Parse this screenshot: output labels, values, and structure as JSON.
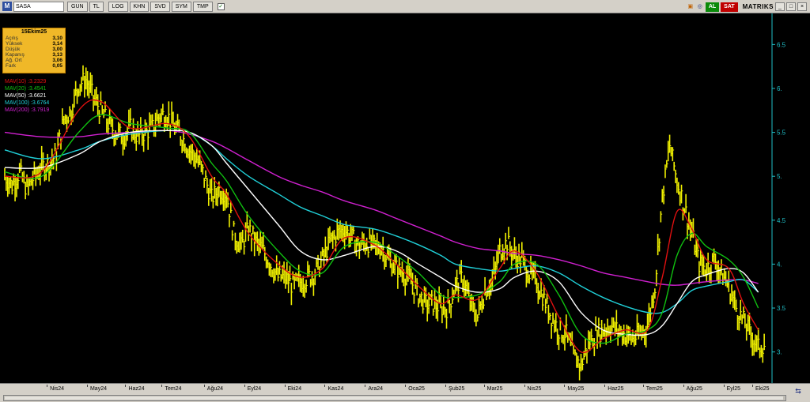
{
  "toolbar": {
    "app_icon": "M",
    "symbol": "SASA",
    "buttons": [
      "GUN",
      "TL",
      "LOG",
      "KHN",
      "SVD",
      "SYM",
      "TMP"
    ],
    "checkbox_glyph": "✓",
    "right": {
      "al_label": "AL",
      "sat_label": "SAT",
      "matriks_label": "MATRIKS"
    }
  },
  "info_box": {
    "date": "15Ekim25",
    "rows": [
      {
        "label": "Açılış",
        "value": "3,10"
      },
      {
        "label": "Yüksek",
        "value": "3,14"
      },
      {
        "label": "Düşük",
        "value": "3,00"
      },
      {
        "label": "Kapanış",
        "value": "3,13"
      },
      {
        "label": "Ağ. Ort",
        "value": "3,06"
      },
      {
        "label": "Fark",
        "value": "0,05"
      }
    ]
  },
  "legend": [
    {
      "label": "MAV(10)",
      "value": ":3.2329",
      "color": "#e01010"
    },
    {
      "label": "MAV(20)",
      "value": ":3.4541",
      "color": "#10c010"
    },
    {
      "label": "MAV(50)",
      "value": ":3.6621",
      "color": "#ffffff"
    },
    {
      "label": "MAV(100)",
      "value": ":3.6764",
      "color": "#20d0d8"
    },
    {
      "label": "MAV(200)",
      "value": ":3.7919",
      "color": "#d020d0"
    }
  ],
  "chart_data": {
    "type": "line",
    "price_color": "#f0f000",
    "axis_color": "#20c0c8",
    "ylim": [
      2.7,
      6.8
    ],
    "y_ticks": [
      {
        "value": 6.5,
        "label": "6.5"
      },
      {
        "value": 6.0,
        "label": "6."
      },
      {
        "value": 5.5,
        "label": "5.5"
      },
      {
        "value": 5.0,
        "label": "5."
      },
      {
        "value": 4.5,
        "label": "4.5"
      },
      {
        "value": 4.0,
        "label": "4."
      },
      {
        "value": 3.5,
        "label": "3.5"
      },
      {
        "value": 3.0,
        "label": "3."
      }
    ],
    "x_labels": [
      "Nis24",
      "May24",
      "Haz24",
      "Tem24",
      "Ağu24",
      "Eyl24",
      "Eki24",
      "Kas24",
      "Ara24",
      "Oca25",
      "Şub25",
      "Mar25",
      "Nis25",
      "May25",
      "Haz25",
      "Tem25",
      "Ağu25",
      "Eyl25",
      "Eki25"
    ],
    "x_label_pos": [
      0.6,
      1.65,
      2.65,
      3.6,
      4.7,
      5.75,
      6.8,
      7.85,
      8.9,
      9.95,
      11.0,
      12.0,
      13.05,
      14.1,
      15.15,
      16.15,
      17.2,
      18.25,
      19.25
    ],
    "x_domain": [
      0,
      19.6
    ],
    "price": [
      [
        0.0,
        5.0
      ],
      [
        0.2,
        4.9
      ],
      [
        0.4,
        5.05
      ],
      [
        0.6,
        4.85
      ],
      [
        0.8,
        5.0
      ],
      [
        1.0,
        5.1
      ],
      [
        1.2,
        5.15
      ],
      [
        1.4,
        5.25
      ],
      [
        1.6,
        5.65
      ],
      [
        1.8,
        5.75
      ],
      [
        2.0,
        6.05
      ],
      [
        2.2,
        6.1
      ],
      [
        2.4,
        5.9
      ],
      [
        2.6,
        5.75
      ],
      [
        2.8,
        5.6
      ],
      [
        3.0,
        5.5
      ],
      [
        3.2,
        5.45
      ],
      [
        3.4,
        5.55
      ],
      [
        3.6,
        5.45
      ],
      [
        3.8,
        5.5
      ],
      [
        4.0,
        5.55
      ],
      [
        4.2,
        5.7
      ],
      [
        4.4,
        5.7
      ],
      [
        4.6,
        5.55
      ],
      [
        4.8,
        5.45
      ],
      [
        5.0,
        5.3
      ],
      [
        5.2,
        5.2
      ],
      [
        5.4,
        5.0
      ],
      [
        5.6,
        4.75
      ],
      [
        5.8,
        4.85
      ],
      [
        6.0,
        4.8
      ],
      [
        6.2,
        4.35
      ],
      [
        6.4,
        4.2
      ],
      [
        6.6,
        4.4
      ],
      [
        6.8,
        4.25
      ],
      [
        7.0,
        4.15
      ],
      [
        7.2,
        4.0
      ],
      [
        7.4,
        3.85
      ],
      [
        7.6,
        3.85
      ],
      [
        7.8,
        3.75
      ],
      [
        8.0,
        3.8
      ],
      [
        8.2,
        3.85
      ],
      [
        8.4,
        3.9
      ],
      [
        8.6,
        4.05
      ],
      [
        8.8,
        4.25
      ],
      [
        9.0,
        4.35
      ],
      [
        9.2,
        4.4
      ],
      [
        9.4,
        4.3
      ],
      [
        9.6,
        4.2
      ],
      [
        9.8,
        4.25
      ],
      [
        10.0,
        4.2
      ],
      [
        10.2,
        4.2
      ],
      [
        10.4,
        4.05
      ],
      [
        10.6,
        3.95
      ],
      [
        10.8,
        3.9
      ],
      [
        11.0,
        3.8
      ],
      [
        11.2,
        3.65
      ],
      [
        11.4,
        3.55
      ],
      [
        11.6,
        3.55
      ],
      [
        11.8,
        3.5
      ],
      [
        12.0,
        3.5
      ],
      [
        12.2,
        3.75
      ],
      [
        12.4,
        3.85
      ],
      [
        12.6,
        3.55
      ],
      [
        12.8,
        3.4
      ],
      [
        13.0,
        3.7
      ],
      [
        13.2,
        3.8
      ],
      [
        13.4,
        4.15
      ],
      [
        13.6,
        4.25
      ],
      [
        13.8,
        4.1
      ],
      [
        14.0,
        4.05
      ],
      [
        14.2,
        3.9
      ],
      [
        14.4,
        3.8
      ],
      [
        14.6,
        3.6
      ],
      [
        14.8,
        3.4
      ],
      [
        15.0,
        3.25
      ],
      [
        15.2,
        3.2
      ],
      [
        15.4,
        2.95
      ],
      [
        15.6,
        2.85
      ],
      [
        15.8,
        3.1
      ],
      [
        16.0,
        3.2
      ],
      [
        16.2,
        3.25
      ],
      [
        16.4,
        3.3
      ],
      [
        16.6,
        3.25
      ],
      [
        16.8,
        3.2
      ],
      [
        17.0,
        3.15
      ],
      [
        17.2,
        3.2
      ],
      [
        17.4,
        3.3
      ],
      [
        17.6,
        3.75
      ],
      [
        17.8,
        4.75
      ],
      [
        18.0,
        5.35
      ],
      [
        18.2,
        4.95
      ],
      [
        18.4,
        4.65
      ],
      [
        18.6,
        4.35
      ],
      [
        18.8,
        4.0
      ],
      [
        19.0,
        3.95
      ],
      [
        19.2,
        4.05
      ],
      [
        19.4,
        3.9
      ],
      [
        19.6,
        3.75
      ],
      [
        19.8,
        3.5
      ],
      [
        20.0,
        3.35
      ],
      [
        20.2,
        3.2
      ],
      [
        20.4,
        3.05
      ],
      [
        20.6,
        3.1
      ]
    ],
    "series": [
      {
        "name": "MAV(10)",
        "color": "#e01010",
        "points": [
          [
            0.0,
            5.0
          ],
          [
            1.0,
            5.05
          ],
          [
            2.0,
            5.75
          ],
          [
            2.6,
            5.85
          ],
          [
            3.4,
            5.55
          ],
          [
            4.4,
            5.6
          ],
          [
            5.0,
            5.45
          ],
          [
            5.6,
            5.0
          ],
          [
            6.0,
            4.8
          ],
          [
            6.6,
            4.35
          ],
          [
            7.4,
            4.0
          ],
          [
            8.0,
            3.85
          ],
          [
            8.6,
            3.95
          ],
          [
            9.2,
            4.3
          ],
          [
            10.0,
            4.22
          ],
          [
            10.6,
            4.0
          ],
          [
            11.2,
            3.75
          ],
          [
            11.8,
            3.55
          ],
          [
            12.2,
            3.65
          ],
          [
            12.8,
            3.6
          ],
          [
            13.4,
            3.95
          ],
          [
            13.8,
            4.15
          ],
          [
            14.4,
            3.9
          ],
          [
            15.0,
            3.4
          ],
          [
            15.6,
            3.0
          ],
          [
            16.2,
            3.15
          ],
          [
            16.8,
            3.25
          ],
          [
            17.4,
            3.25
          ],
          [
            17.8,
            3.85
          ],
          [
            18.2,
            4.6
          ],
          [
            18.6,
            4.4
          ],
          [
            19.0,
            4.05
          ],
          [
            19.6,
            3.95
          ],
          [
            20.0,
            3.55
          ],
          [
            20.4,
            3.25
          ]
        ]
      },
      {
        "name": "MAV(20)",
        "color": "#10c010",
        "points": [
          [
            0.0,
            5.05
          ],
          [
            1.0,
            5.0
          ],
          [
            2.0,
            5.5
          ],
          [
            2.6,
            5.7
          ],
          [
            3.4,
            5.6
          ],
          [
            4.4,
            5.55
          ],
          [
            5.0,
            5.5
          ],
          [
            5.6,
            5.15
          ],
          [
            6.0,
            4.95
          ],
          [
            6.6,
            4.55
          ],
          [
            7.4,
            4.15
          ],
          [
            8.0,
            3.92
          ],
          [
            8.6,
            3.9
          ],
          [
            9.2,
            4.2
          ],
          [
            10.0,
            4.25
          ],
          [
            10.6,
            4.1
          ],
          [
            11.2,
            3.9
          ],
          [
            11.8,
            3.65
          ],
          [
            12.2,
            3.62
          ],
          [
            12.8,
            3.65
          ],
          [
            13.4,
            3.8
          ],
          [
            13.8,
            4.0
          ],
          [
            14.4,
            4.0
          ],
          [
            15.0,
            3.65
          ],
          [
            15.6,
            3.2
          ],
          [
            16.2,
            3.1
          ],
          [
            16.8,
            3.2
          ],
          [
            17.4,
            3.25
          ],
          [
            17.8,
            3.45
          ],
          [
            18.2,
            4.1
          ],
          [
            18.6,
            4.35
          ],
          [
            19.0,
            4.2
          ],
          [
            19.6,
            4.05
          ],
          [
            20.0,
            3.85
          ],
          [
            20.4,
            3.5
          ]
        ]
      },
      {
        "name": "MAV(50)",
        "color": "#ffffff",
        "points": [
          [
            0.0,
            5.1
          ],
          [
            1.0,
            5.1
          ],
          [
            2.0,
            5.25
          ],
          [
            2.6,
            5.4
          ],
          [
            3.4,
            5.5
          ],
          [
            4.4,
            5.52
          ],
          [
            5.0,
            5.5
          ],
          [
            5.6,
            5.35
          ],
          [
            6.0,
            5.15
          ],
          [
            6.6,
            4.85
          ],
          [
            7.4,
            4.45
          ],
          [
            8.0,
            4.15
          ],
          [
            8.6,
            4.05
          ],
          [
            9.2,
            4.1
          ],
          [
            10.0,
            4.2
          ],
          [
            10.6,
            4.15
          ],
          [
            11.2,
            4.0
          ],
          [
            11.8,
            3.85
          ],
          [
            12.2,
            3.75
          ],
          [
            12.8,
            3.68
          ],
          [
            13.4,
            3.72
          ],
          [
            13.8,
            3.85
          ],
          [
            14.4,
            3.92
          ],
          [
            15.0,
            3.8
          ],
          [
            15.6,
            3.45
          ],
          [
            16.2,
            3.25
          ],
          [
            16.8,
            3.2
          ],
          [
            17.4,
            3.2
          ],
          [
            17.8,
            3.3
          ],
          [
            18.2,
            3.55
          ],
          [
            18.6,
            3.8
          ],
          [
            19.0,
            3.88
          ],
          [
            19.6,
            3.95
          ],
          [
            20.0,
            3.9
          ],
          [
            20.4,
            3.68
          ]
        ]
      },
      {
        "name": "MAV(100)",
        "color": "#20d0d8",
        "points": [
          [
            0.0,
            5.3
          ],
          [
            1.0,
            5.2
          ],
          [
            2.0,
            5.3
          ],
          [
            2.6,
            5.4
          ],
          [
            3.4,
            5.48
          ],
          [
            4.4,
            5.52
          ],
          [
            5.0,
            5.5
          ],
          [
            5.6,
            5.35
          ],
          [
            6.0,
            5.2
          ],
          [
            6.6,
            5.0
          ],
          [
            7.4,
            4.8
          ],
          [
            8.0,
            4.65
          ],
          [
            8.6,
            4.55
          ],
          [
            9.2,
            4.45
          ],
          [
            10.0,
            4.4
          ],
          [
            10.6,
            4.32
          ],
          [
            11.2,
            4.22
          ],
          [
            11.8,
            4.1
          ],
          [
            12.2,
            4.0
          ],
          [
            12.8,
            3.95
          ],
          [
            13.4,
            3.92
          ],
          [
            13.8,
            3.95
          ],
          [
            14.4,
            3.98
          ],
          [
            15.0,
            3.9
          ],
          [
            15.6,
            3.75
          ],
          [
            16.2,
            3.62
          ],
          [
            16.8,
            3.52
          ],
          [
            17.4,
            3.45
          ],
          [
            17.8,
            3.45
          ],
          [
            18.2,
            3.55
          ],
          [
            18.6,
            3.7
          ],
          [
            19.0,
            3.75
          ],
          [
            19.6,
            3.8
          ],
          [
            20.0,
            3.82
          ],
          [
            20.4,
            3.68
          ]
        ]
      },
      {
        "name": "MAV(200)",
        "color": "#d020d0",
        "points": [
          [
            0.0,
            5.5
          ],
          [
            1.0,
            5.45
          ],
          [
            2.0,
            5.45
          ],
          [
            2.6,
            5.48
          ],
          [
            3.4,
            5.5
          ],
          [
            4.4,
            5.52
          ],
          [
            5.0,
            5.48
          ],
          [
            5.6,
            5.4
          ],
          [
            6.0,
            5.32
          ],
          [
            6.6,
            5.18
          ],
          [
            7.4,
            5.0
          ],
          [
            8.0,
            4.9
          ],
          [
            8.6,
            4.82
          ],
          [
            9.2,
            4.72
          ],
          [
            10.0,
            4.62
          ],
          [
            10.6,
            4.52
          ],
          [
            11.2,
            4.42
          ],
          [
            11.8,
            4.32
          ],
          [
            12.2,
            4.25
          ],
          [
            12.8,
            4.18
          ],
          [
            13.4,
            4.15
          ],
          [
            13.8,
            4.12
          ],
          [
            14.4,
            4.1
          ],
          [
            15.0,
            4.05
          ],
          [
            15.6,
            3.98
          ],
          [
            16.2,
            3.9
          ],
          [
            16.8,
            3.85
          ],
          [
            17.4,
            3.8
          ],
          [
            17.8,
            3.77
          ],
          [
            18.2,
            3.76
          ],
          [
            18.6,
            3.78
          ],
          [
            19.0,
            3.8
          ],
          [
            19.6,
            3.82
          ],
          [
            20.0,
            3.82
          ],
          [
            20.4,
            3.78
          ]
        ]
      }
    ]
  }
}
